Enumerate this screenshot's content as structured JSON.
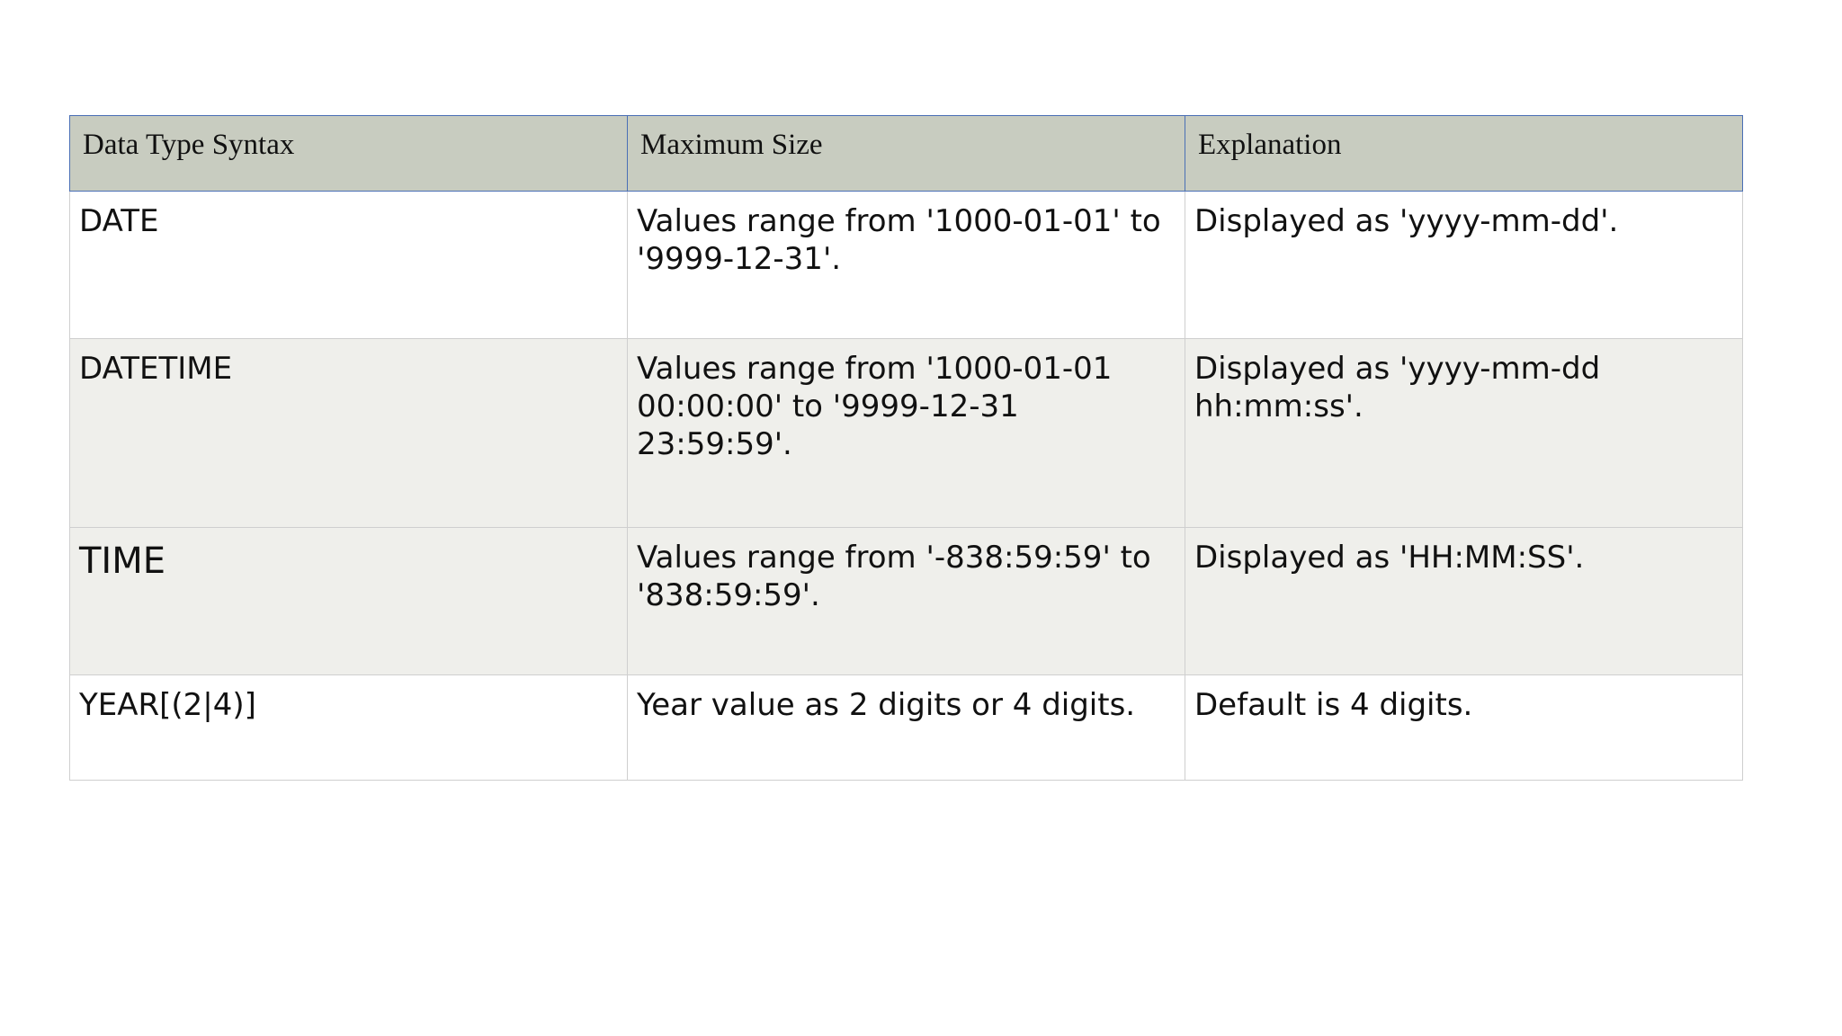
{
  "table": {
    "headers": [
      "Data Type Syntax",
      "Maximum Size",
      "Explanation"
    ],
    "rows": [
      [
        "DATE",
        "Values range from '1000-01-01' to '9999-12-31'.",
        "Displayed as 'yyyy-mm-dd'."
      ],
      [
        "DATETIME",
        "Values range from '1000-01-01 00:00:00' to '9999-12-31 23:59:59'.",
        "Displayed as 'yyyy-mm-dd hh:mm:ss'."
      ],
      [
        "TIME",
        "Values range from '-838:59:59' to '838:59:59'.",
        "Displayed as 'HH:MM:SS'."
      ],
      [
        "YEAR[(2|4)]",
        "Year value as 2 digits or 4 digits.",
        "Default is 4 digits."
      ]
    ]
  },
  "colors": {
    "header_bg": "#c8ccc0",
    "header_border": "#4a6fb5",
    "row_alt_bg": "#efefeb",
    "cell_border": "#cfcfcf"
  }
}
